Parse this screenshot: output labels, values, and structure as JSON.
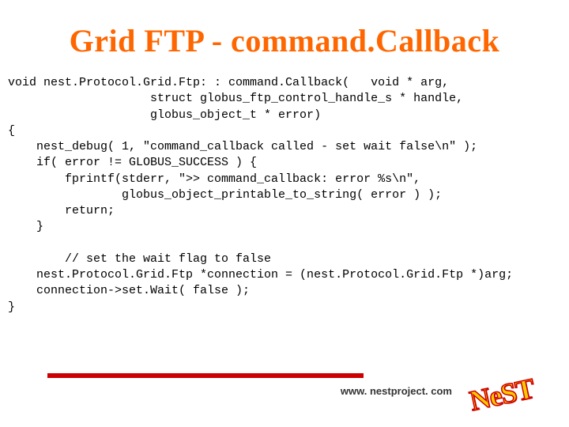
{
  "title": "Grid FTP - command.Callback",
  "code_lines": [
    "void nest.Protocol.Grid.Ftp: : command.Callback(   void * arg,",
    "                    struct globus_ftp_control_handle_s * handle,",
    "                    globus_object_t * error)",
    "{",
    "    nest_debug( 1, \"command_callback called - set wait false\\n\" );",
    "    if( error != GLOBUS_SUCCESS ) {",
    "        fprintf(stderr, \">> command_callback: error %s\\n\",",
    "                globus_object_printable_to_string( error ) );",
    "        return;",
    "    }",
    "",
    "        // set the wait flag to false",
    "    nest.Protocol.Grid.Ftp *connection = (nest.Protocol.Grid.Ftp *)arg;",
    "    connection->set.Wait( false );",
    "}"
  ],
  "footer_url": "www. nestproject. com",
  "logo_text": "NeST"
}
